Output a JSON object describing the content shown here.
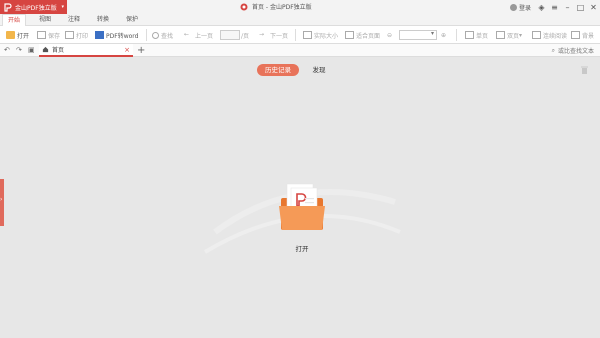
{
  "app_button": {
    "label": "金山PDF独立版"
  },
  "window": {
    "title": "首页 - 金山PDF独立版",
    "login": "登录"
  },
  "menu_tabs": [
    "开始",
    "视图",
    "注释",
    "转换",
    "保护"
  ],
  "toolbar": {
    "open": "打开",
    "save": "保存",
    "print": "打印",
    "pdf2word": "PDF转word",
    "find": "查找",
    "prev": "上一页",
    "page_suffix": "/页",
    "next": "下一页",
    "actual_size": "实际大小",
    "fit_page": "适合页面",
    "single": "单页",
    "double": "双页",
    "continuous": "连续阅读",
    "background": "背景"
  },
  "doc_tab": {
    "label": "首页"
  },
  "search_text": "或比查找文本",
  "main": {
    "tab_history": "历史记录",
    "tab_discover": "发现",
    "open_label": "打开"
  },
  "colors": {
    "accent": "#d64541",
    "pill": "#e8735a",
    "folder": "#f08a4b"
  }
}
